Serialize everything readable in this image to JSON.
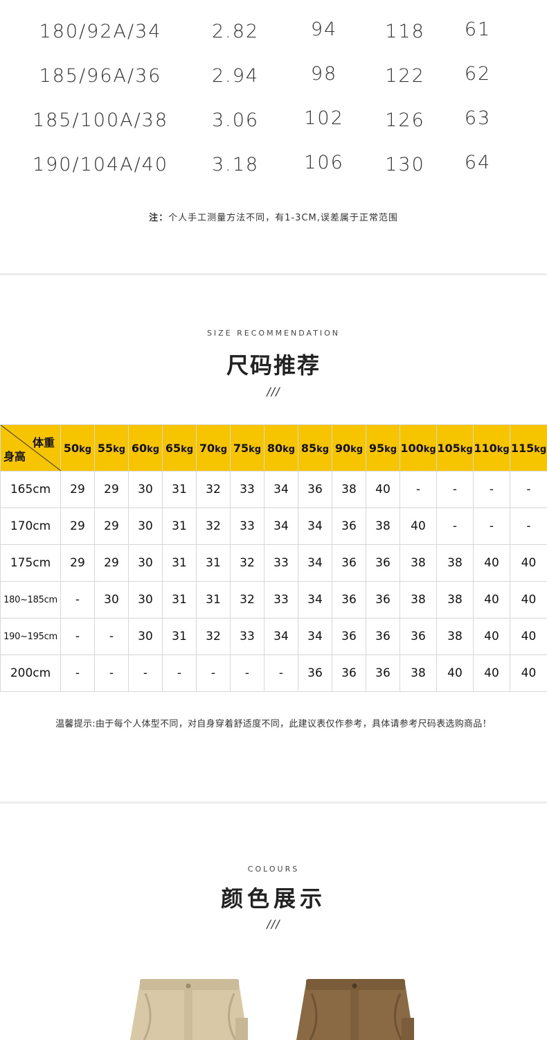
{
  "measure_rows": [
    [
      "180/92A/34",
      "2.82",
      "94",
      "118",
      "61"
    ],
    [
      "185/96A/36",
      "2.94",
      "98",
      "122",
      "62"
    ],
    [
      "185/100A/38",
      "3.06",
      "102",
      "126",
      "63"
    ],
    [
      "190/104A/40",
      "3.18",
      "106",
      "130",
      "64"
    ]
  ],
  "measure_note": {
    "label": "注：",
    "text": "个人手工测量方法不同，有1-3CM,误差属于正常范围"
  },
  "recommendation": {
    "eng_title": "SIZE RECOMMENDATION",
    "title": "尺码推荐",
    "slash": "///",
    "corner_weight": "体重",
    "corner_height": "身高",
    "weights": [
      "50",
      "55",
      "60",
      "65",
      "70",
      "75",
      "80",
      "85",
      "90",
      "95",
      "100",
      "105",
      "110",
      "115"
    ],
    "unit": "kg",
    "rows": [
      {
        "height": "165cm",
        "values": [
          "29",
          "29",
          "30",
          "31",
          "32",
          "33",
          "34",
          "36",
          "38",
          "40",
          "-",
          "-",
          "-",
          "-"
        ]
      },
      {
        "height": "170cm",
        "values": [
          "29",
          "29",
          "30",
          "31",
          "32",
          "33",
          "34",
          "34",
          "36",
          "38",
          "40",
          "-",
          "-",
          "-"
        ]
      },
      {
        "height": "175cm",
        "values": [
          "29",
          "29",
          "30",
          "31",
          "31",
          "32",
          "33",
          "34",
          "36",
          "36",
          "38",
          "38",
          "40",
          "40"
        ]
      },
      {
        "height": "180~185cm",
        "values": [
          "-",
          "30",
          "30",
          "31",
          "31",
          "32",
          "33",
          "34",
          "36",
          "36",
          "38",
          "38",
          "40",
          "40"
        ]
      },
      {
        "height": "190~195cm",
        "values": [
          "-",
          "-",
          "30",
          "31",
          "32",
          "33",
          "34",
          "34",
          "36",
          "36",
          "36",
          "38",
          "40",
          "40"
        ]
      },
      {
        "height": "200cm",
        "values": [
          "-",
          "-",
          "-",
          "-",
          "-",
          "-",
          "-",
          "36",
          "36",
          "36",
          "38",
          "40",
          "40",
          "40"
        ]
      }
    ],
    "note": "温馨提示:由于每个人体型不同，对自身穿着舒适度不同，此建议表仅作参考，具体请参考尺码表选购商品！"
  },
  "colours": {
    "eng_title": "COLOURS",
    "title": "颜色展示",
    "slash": "///",
    "swatches": [
      "#d8c8a6",
      "#8a6a44"
    ]
  }
}
